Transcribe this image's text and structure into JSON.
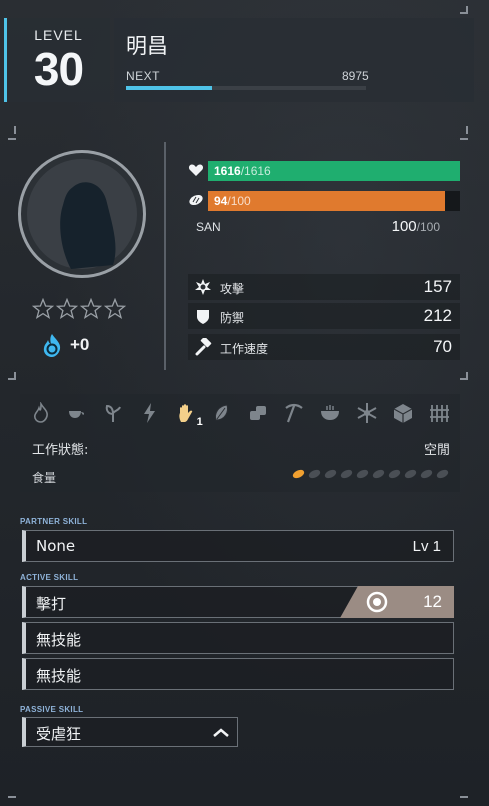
{
  "header": {
    "level_label": "LEVEL",
    "level_value": "30",
    "name": "明昌",
    "next_label": "NEXT",
    "next_value": "8975",
    "xp_progress": 0.36
  },
  "portrait": {
    "rarity_stars": 0,
    "max_stars": 4
  },
  "soul": {
    "value": "+0"
  },
  "vitals": {
    "hp": {
      "current": "1616",
      "max": "/1616",
      "fraction": 1.0,
      "color": "#1fae6f"
    },
    "hunger": {
      "current": "94",
      "max": "/100",
      "fraction": 0.94,
      "color": "#e07a2e"
    },
    "san": {
      "label": "SAN",
      "current": "100",
      "max": "/100"
    }
  },
  "stats": [
    {
      "icon": "attack-icon",
      "label": "攻擊",
      "value": "157"
    },
    {
      "icon": "defense-icon",
      "label": "防禦",
      "value": "212"
    },
    {
      "icon": "work-speed-icon",
      "label": "工作速度",
      "value": "70"
    }
  ],
  "work_suitability": {
    "icons": [
      "kindling-icon",
      "watering-icon",
      "planting-icon",
      "electricity-icon",
      "handiwork-icon",
      "gathering-icon",
      "lumbering-icon",
      "mining-icon",
      "medicine-icon",
      "cooling-icon",
      "transporting-icon",
      "farming-icon"
    ],
    "handiwork_level": "1",
    "status_label": "工作狀態:",
    "status_value": "空閒",
    "food_label": "食量",
    "food_total": 10,
    "food_filled": 1
  },
  "skills": {
    "partner_title": "PARTNER SKILL",
    "partner": {
      "name": "None",
      "level": "Lv  1"
    },
    "active_title": "ACTIVE SKILL",
    "active": [
      {
        "name": "擊打",
        "cost": "12"
      },
      {
        "name": "無技能"
      },
      {
        "name": "無技能"
      }
    ],
    "passive_title": "PASSIVE SKILL",
    "passive": {
      "name": "受虐狂"
    }
  },
  "colors": {
    "accent": "#4fc3e8",
    "cost_bg": "#9b8c84"
  }
}
